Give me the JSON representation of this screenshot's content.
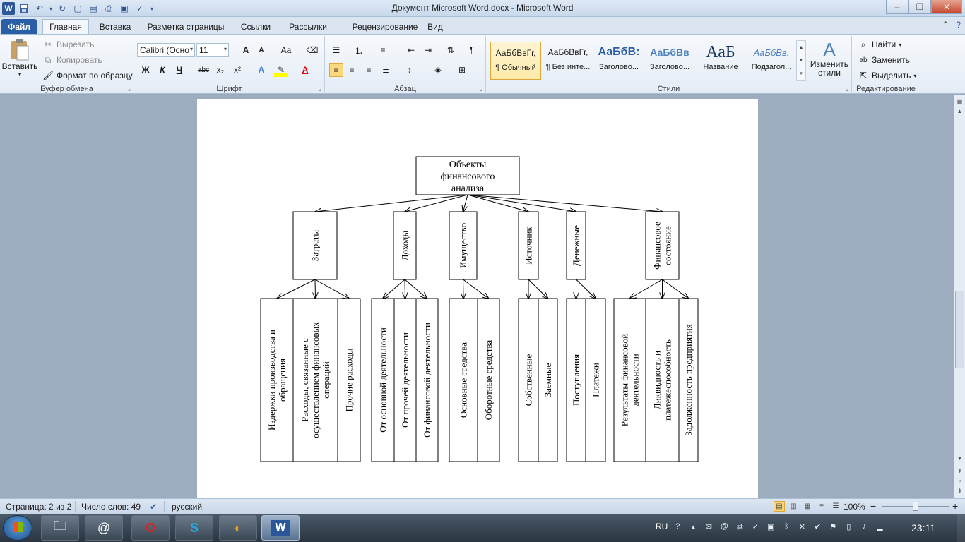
{
  "window": {
    "title": "Документ Microsoft Word.docx  -  Microsoft Word",
    "app_icon": "W"
  },
  "tabs": [
    {
      "label": "Файл"
    },
    {
      "label": "Главная"
    },
    {
      "label": "Вставка"
    },
    {
      "label": "Разметка страницы"
    },
    {
      "label": "Ссылки"
    },
    {
      "label": "Рассылки"
    },
    {
      "label": "Рецензирование"
    },
    {
      "label": "Вид"
    }
  ],
  "ribbon": {
    "clipboard": {
      "group_label": "Буфер обмена",
      "paste": "Вставить",
      "cut": "Вырезать",
      "copy": "Копировать",
      "format_painter": "Формат по образцу"
    },
    "font": {
      "group_label": "Шрифт",
      "font_name": "Calibri (Осно",
      "font_size": "11",
      "grow": "A",
      "shrink": "A",
      "change_case": "Aa",
      "bold": "Ж",
      "italic": "К",
      "underline": "Ч",
      "strike": "abc",
      "subscript": "x₂",
      "superscript": "x²"
    },
    "paragraph": {
      "group_label": "Абзац",
      "pilcrow": "¶"
    },
    "styles": {
      "group_label": "Стили",
      "items": [
        {
          "sample": "АаБбВвГг,",
          "name": "¶ Обычный"
        },
        {
          "sample": "АаБбВвГг,",
          "name": "¶ Без инте..."
        },
        {
          "sample": "АаБбВ:",
          "name": "Заголово..."
        },
        {
          "sample": "АаБбВв",
          "name": "Заголово..."
        },
        {
          "sample": "АаБ",
          "name": "Название"
        },
        {
          "sample": "АаБбВв.",
          "name": "Подзагол..."
        }
      ],
      "change_styles_line1": "Изменить",
      "change_styles_line2": "стили"
    },
    "editing": {
      "group_label": "Редактирование",
      "find": "Найти",
      "replace": "Заменить",
      "select": "Выделить"
    }
  },
  "diagram": {
    "root": "Объекты финансового анализа",
    "root_lines": [
      "Объекты",
      "финансового",
      "анализа"
    ],
    "categories": [
      {
        "label": "Затраты",
        "lines": [
          "Затраты"
        ],
        "children": [
          {
            "lines": [
              "Издержки производства и",
              "обращения"
            ]
          },
          {
            "lines": [
              "Расходы, связанные с",
              "осуществлением финансовых",
              "операций"
            ]
          },
          {
            "lines": [
              "Прочие расходы"
            ]
          }
        ]
      },
      {
        "label": "Доходы",
        "lines": [
          "Доходы"
        ],
        "children": [
          {
            "lines": [
              "От основной деятельности"
            ]
          },
          {
            "lines": [
              "От прочей деятельности"
            ]
          },
          {
            "lines": [
              "От финансовой деятельности"
            ]
          }
        ]
      },
      {
        "label": "Имущество",
        "lines": [
          "Имущество"
        ],
        "children": [
          {
            "lines": [
              "Основные средства"
            ]
          },
          {
            "lines": [
              "Оборотные средства"
            ]
          }
        ]
      },
      {
        "label": "Источник",
        "lines": [
          "Источник"
        ],
        "children": [
          {
            "lines": [
              "Собственные"
            ]
          },
          {
            "lines": [
              "Заемные"
            ]
          }
        ]
      },
      {
        "label": "Денежные",
        "lines": [
          "Денежные"
        ],
        "children": [
          {
            "lines": [
              "Поступления"
            ]
          },
          {
            "lines": [
              "Платежи"
            ]
          }
        ]
      },
      {
        "label": "Финансовое состояние",
        "lines": [
          "Финансовое",
          "состояние"
        ],
        "children": [
          {
            "lines": [
              "Результаты финансовой",
              "деятельности"
            ]
          },
          {
            "lines": [
              "Ликвидность и",
              "платежеспособность"
            ]
          },
          {
            "lines": [
              "Задолженность предприятия"
            ]
          }
        ]
      }
    ]
  },
  "statusbar": {
    "page": "Страница: 2 из 2",
    "words": "Число слов: 49",
    "language": "русский",
    "zoom": "100%",
    "zoom_minus": "−",
    "zoom_plus": "+"
  },
  "taskbar": {
    "lang": "RU",
    "time": "23:11"
  }
}
